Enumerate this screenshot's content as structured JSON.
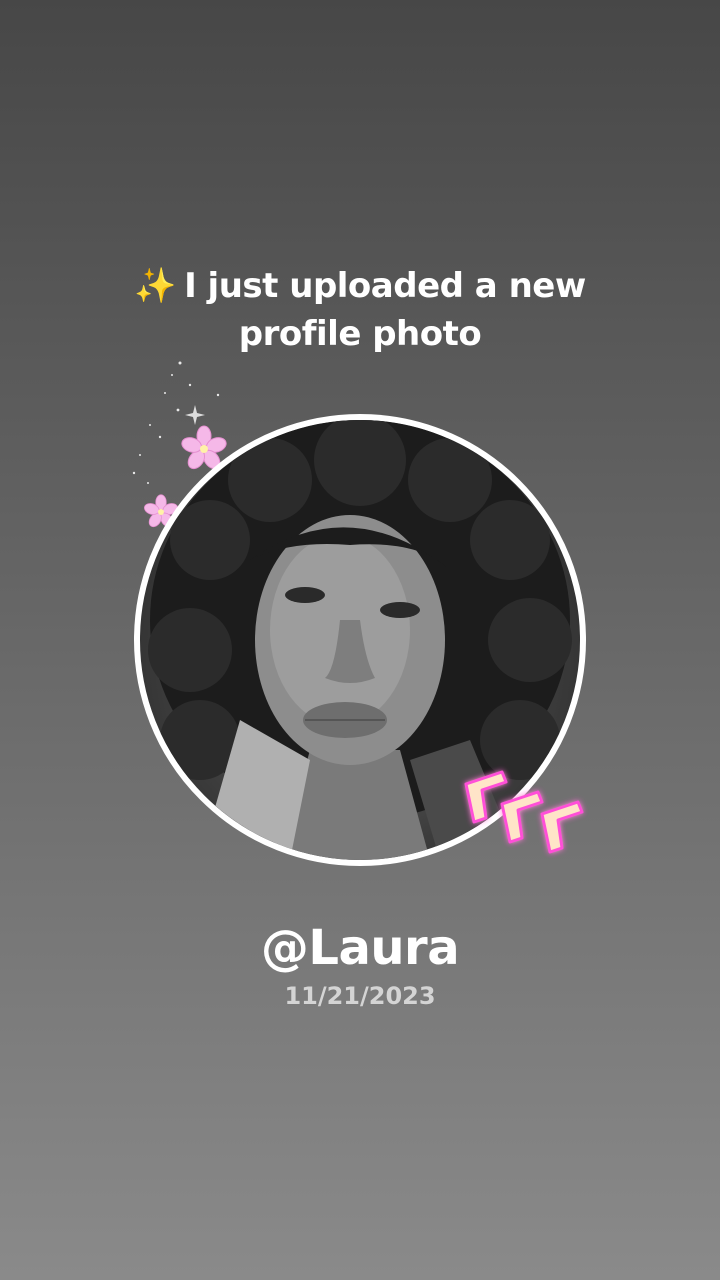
{
  "post": {
    "sparkle_emoji": "✨",
    "headline_line1": "I just uploaded a new",
    "headline_line2": "profile photo",
    "username": "@Laura",
    "date": "11/21/2023"
  },
  "decorations": {
    "flower_color": "#f5b8e8",
    "arrow_glow_color": "#ff4fd8",
    "arrow_fill_color": "#ffe4c8",
    "ring_color": "#ffffff"
  },
  "icons": {
    "sparkle": "sparkles-icon",
    "flower": "cherry-blossom-icon",
    "arrows": "neon-chevron-arrows-icon"
  }
}
